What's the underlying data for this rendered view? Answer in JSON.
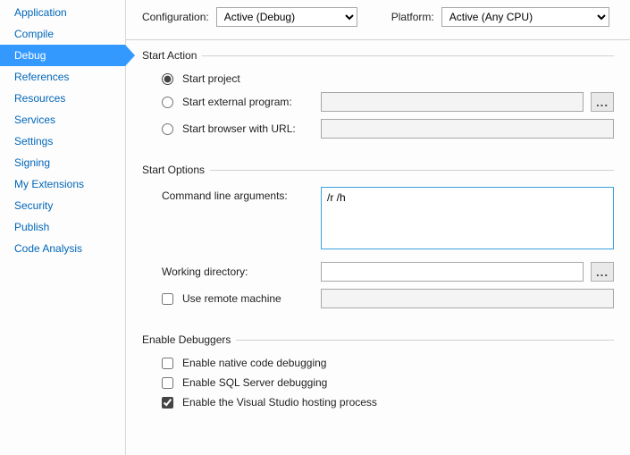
{
  "sidebar": {
    "items": [
      {
        "label": "Application",
        "active": false
      },
      {
        "label": "Compile",
        "active": false
      },
      {
        "label": "Debug",
        "active": true
      },
      {
        "label": "References",
        "active": false
      },
      {
        "label": "Resources",
        "active": false
      },
      {
        "label": "Services",
        "active": false
      },
      {
        "label": "Settings",
        "active": false
      },
      {
        "label": "Signing",
        "active": false
      },
      {
        "label": "My Extensions",
        "active": false
      },
      {
        "label": "Security",
        "active": false
      },
      {
        "label": "Publish",
        "active": false
      },
      {
        "label": "Code Analysis",
        "active": false
      }
    ]
  },
  "top": {
    "configuration_label": "Configuration:",
    "configuration_value": "Active (Debug)",
    "platform_label": "Platform:",
    "platform_value": "Active (Any CPU)"
  },
  "start_action": {
    "legend": "Start Action",
    "start_project": "Start project",
    "start_external": "Start external program:",
    "start_browser": "Start browser with URL:",
    "selected": "project",
    "external_value": "",
    "browser_value": "",
    "browse_label": "..."
  },
  "start_options": {
    "legend": "Start Options",
    "cmdline_label": "Command line arguments:",
    "cmdline_value": "/r /h",
    "workdir_label": "Working directory:",
    "workdir_value": "",
    "browse_label": "...",
    "remote_label": "Use remote machine",
    "remote_checked": false,
    "remote_value": ""
  },
  "debuggers": {
    "legend": "Enable Debuggers",
    "native_label": "Enable native code debugging",
    "native_checked": false,
    "sql_label": "Enable SQL Server debugging",
    "sql_checked": false,
    "hosting_label": "Enable the Visual Studio hosting process",
    "hosting_checked": true
  }
}
